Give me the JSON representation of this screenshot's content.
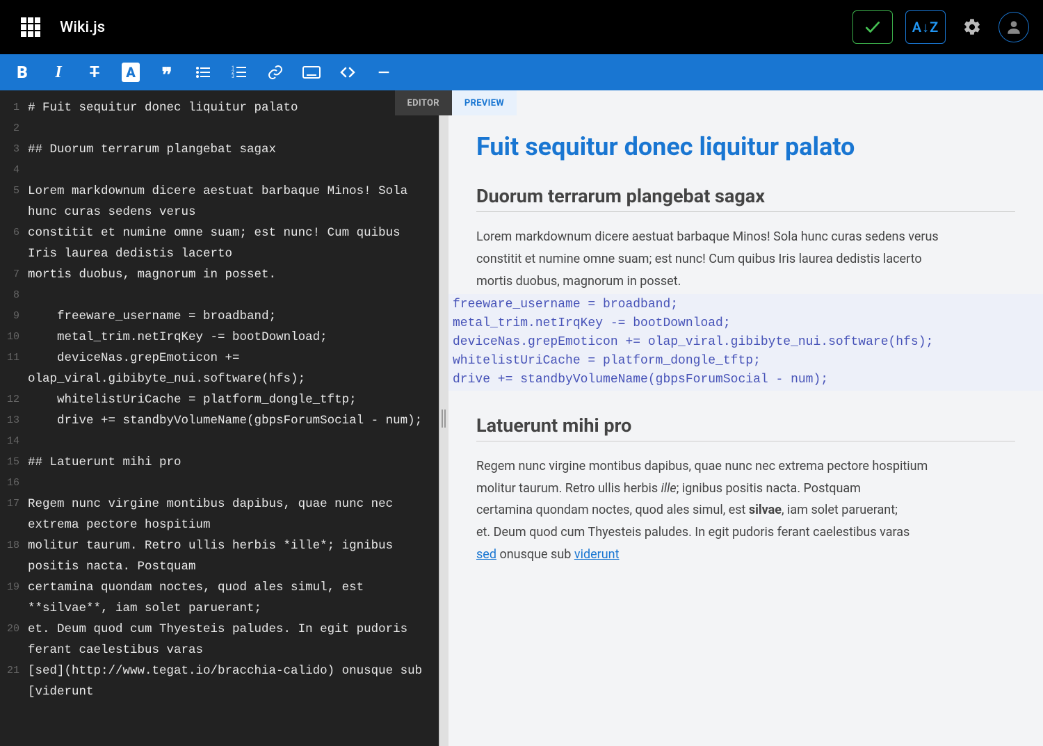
{
  "header": {
    "app_title": "Wiki.js",
    "sort_button_label": "A↓Z",
    "icons": {
      "grid": "app-grid-icon",
      "check": "check-icon",
      "sort": "sort-az-icon",
      "gear": "gear-icon",
      "avatar": "avatar-icon"
    }
  },
  "toolbar": {
    "bold": "B",
    "italic": "I",
    "strike": "T",
    "highlight": "A",
    "quote": "❞"
  },
  "tabs": {
    "editor": "EDITOR",
    "preview": "PREVIEW"
  },
  "editor": {
    "lines": [
      {
        "n": "1",
        "t": "# Fuit sequitur donec liquitur palato"
      },
      {
        "n": "2",
        "t": ""
      },
      {
        "n": "3",
        "t": "## Duorum terrarum plangebat sagax"
      },
      {
        "n": "4",
        "t": ""
      },
      {
        "n": "5",
        "t": "Lorem markdownum dicere aestuat barbaque Minos! Sola hunc curas sedens verus"
      },
      {
        "n": "6",
        "t": "constitit et numine omne suam; est nunc! Cum quibus Iris laurea dedistis lacerto"
      },
      {
        "n": "7",
        "t": "mortis duobus, magnorum in posset."
      },
      {
        "n": "8",
        "t": ""
      },
      {
        "n": "9",
        "t": "    freeware_username = broadband;"
      },
      {
        "n": "10",
        "t": "    metal_trim.netIrqKey -= bootDownload;"
      },
      {
        "n": "11",
        "t": "    deviceNas.grepEmoticon += olap_viral.gibibyte_nui.software(hfs);"
      },
      {
        "n": "12",
        "t": "    whitelistUriCache = platform_dongle_tftp;"
      },
      {
        "n": "13",
        "t": "    drive += standbyVolumeName(gbpsForumSocial - num);"
      },
      {
        "n": "14",
        "t": ""
      },
      {
        "n": "15",
        "t": "## Latuerunt mihi pro"
      },
      {
        "n": "16",
        "t": ""
      },
      {
        "n": "17",
        "t": "Regem nunc virgine montibus dapibus, quae nunc nec extrema pectore hospitium"
      },
      {
        "n": "18",
        "t": "molitur taurum. Retro ullis herbis *ille*; ignibus positis nacta. Postquam"
      },
      {
        "n": "19",
        "t": "certamina quondam noctes, quod ales simul, est **silvae**, iam solet paruerant;"
      },
      {
        "n": "20",
        "t": "et. Deum quod cum Thyesteis paludes. In egit pudoris ferant caelestibus varas"
      },
      {
        "n": "21",
        "t": "[sed](http://www.tegat.io/bracchia-calido) onusque sub [viderunt"
      }
    ]
  },
  "preview": {
    "h1": "Fuit sequitur donec liquitur palato",
    "h2a": "Duorum terrarum plangebat sagax",
    "p1a": "Lorem markdownum dicere aestuat barbaque Minos! Sola hunc curas sedens verus",
    "p1b": "constitit et numine omne suam; est nunc! Cum quibus Iris laurea dedistis lacerto",
    "p1c": "mortis duobus, magnorum in posset.",
    "code": "freeware_username = broadband;\nmetal_trim.netIrqKey -= bootDownload;\ndeviceNas.grepEmoticon += olap_viral.gibibyte_nui.software(hfs);\nwhitelistUriCache = platform_dongle_tftp;\ndrive += standbyVolumeName(gbpsForumSocial - num);",
    "h2b": "Latuerunt mihi pro",
    "p2a": "Regem nunc virgine montibus dapibus, quae nunc nec extrema pectore hospitium",
    "p2b_pre": "molitur taurum. Retro ullis herbis ",
    "p2b_em": "ille",
    "p2b_post": "; ignibus positis nacta. Postquam",
    "p2c_pre": "certamina quondam noctes, quod ales simul, est ",
    "p2c_strong": "silvae",
    "p2c_post": ", iam solet paruerant;",
    "p2d": "et. Deum quod cum Thyesteis paludes. In egit pudoris ferant caelestibus varas",
    "link1_text": "sed",
    "p2e_mid": " onusque sub ",
    "link2_text": "viderunt"
  }
}
